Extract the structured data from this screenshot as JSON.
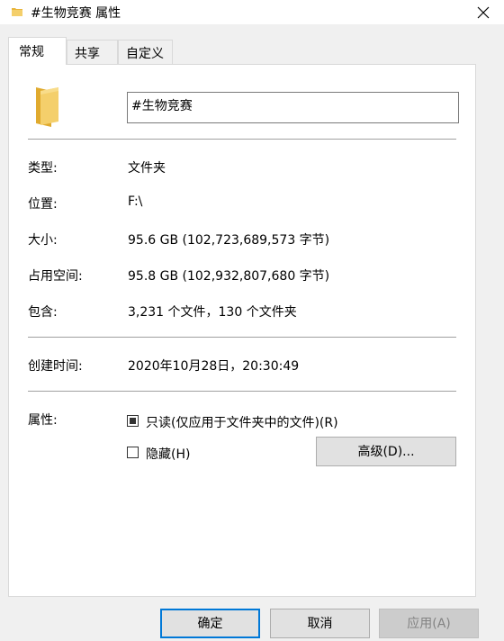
{
  "window": {
    "title": "#生物竞赛 属性"
  },
  "tabs": [
    {
      "label": "常规",
      "active": true
    },
    {
      "label": "共享"
    },
    {
      "label": "自定义"
    }
  ],
  "icons": {
    "folder": "folder-icon",
    "close": "close-icon"
  },
  "folder": {
    "name": "#生物竞赛"
  },
  "fields": {
    "type": {
      "label": "类型:",
      "value": "文件夹"
    },
    "location": {
      "label": "位置:",
      "value": "F:\\"
    },
    "size": {
      "label": "大小:",
      "value": "95.6 GB (102,723,689,573 字节)"
    },
    "size_on_disk": {
      "label": "占用空间:",
      "value": "95.8 GB (102,932,807,680 字节)"
    },
    "contains": {
      "label": "包含:",
      "value": "3,231 个文件，130 个文件夹"
    },
    "created": {
      "label": "创建时间:",
      "value": "2020年10月28日，20:30:49"
    },
    "attributes": {
      "label": "属性:"
    }
  },
  "attributes": {
    "readonly": {
      "label": "只读(仅应用于文件夹中的文件)(R)",
      "state": "indeterminate"
    },
    "hidden": {
      "label": "隐藏(H)",
      "state": "unchecked"
    },
    "advanced_label": "高级(D)..."
  },
  "buttons": {
    "ok": "确定",
    "cancel": "取消",
    "apply": "应用(A)"
  },
  "colors": {
    "accent": "#0078d7",
    "folder": "#f4cf6b",
    "panel": "#ffffff",
    "background": "#f0f0f0"
  }
}
